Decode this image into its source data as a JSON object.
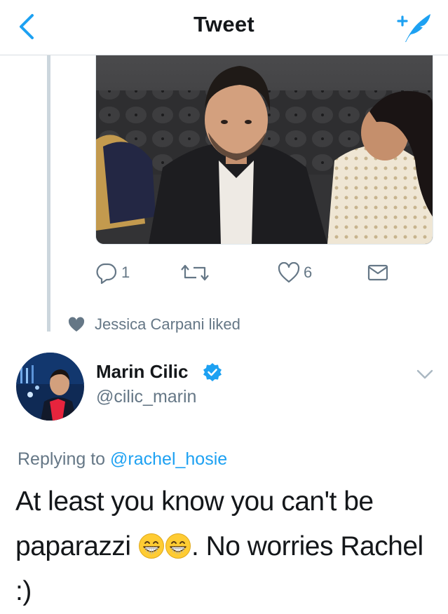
{
  "header": {
    "title": "Tweet",
    "back_icon": "chevron-left-icon",
    "compose_icon": "compose-tweet-icon"
  },
  "actions": {
    "reply_count": "1",
    "like_count": "6"
  },
  "liked_line": {
    "text": "Jessica Carpani liked"
  },
  "tweet": {
    "author_name": "Marin Cilic",
    "author_handle": "@cilic_marin",
    "replying_prefix": "Replying to",
    "replying_handle": "@rachel_hosie",
    "text_part1": "At least you know you can't be paparazzi ",
    "text_part2": ". No worries Rachel :)",
    "emoji": "grinning-face-with-smiling-eyes"
  },
  "colors": {
    "accent": "#1da1f2",
    "muted": "#657786",
    "text": "#14171a",
    "divider": "#d8dde1"
  }
}
